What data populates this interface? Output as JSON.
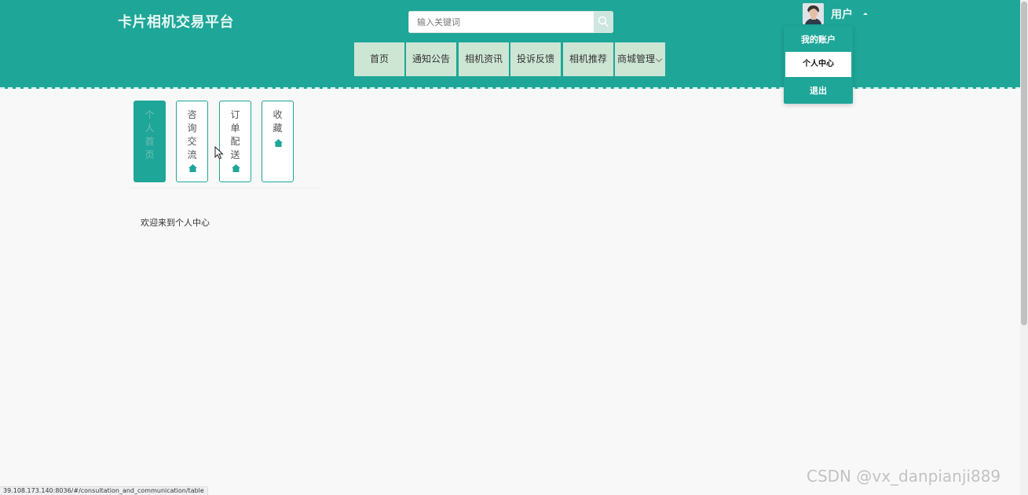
{
  "site_title": "卡片相机交易平台",
  "search": {
    "placeholder": "输入关键词"
  },
  "user": {
    "name": "用户"
  },
  "user_menu": {
    "header": "我的账户",
    "items": [
      {
        "label": "个人中心",
        "active": true
      },
      {
        "label": "退出",
        "active": false
      }
    ]
  },
  "nav": {
    "items": [
      {
        "label": "首页"
      },
      {
        "label": "通知公告"
      },
      {
        "label": "相机资讯"
      },
      {
        "label": "投诉反馈"
      },
      {
        "label": "相机推荐"
      },
      {
        "label": "商城管理",
        "has_dropdown": true
      }
    ]
  },
  "side_tabs": [
    {
      "label": "个\n人\n首\n页",
      "active": true,
      "icon": "home-icon"
    },
    {
      "label": "咨\n询\n交\n流",
      "active": false,
      "icon": "home-icon"
    },
    {
      "label": "订\n单\n配\n送",
      "active": false,
      "icon": "home-icon"
    },
    {
      "label": "收\n藏",
      "active": false,
      "icon": "home-icon"
    }
  ],
  "content": {
    "welcome": "欢迎来到个人中心"
  },
  "status_bar": {
    "url": "39.108.173.140:8036/#/consultation_and_communication/table"
  },
  "watermark": "CSDN @vx_danpianji889",
  "colors": {
    "primary": "#1ea698",
    "nav_bg": "#cde6d4",
    "page_bg": "#f8f8f8"
  }
}
